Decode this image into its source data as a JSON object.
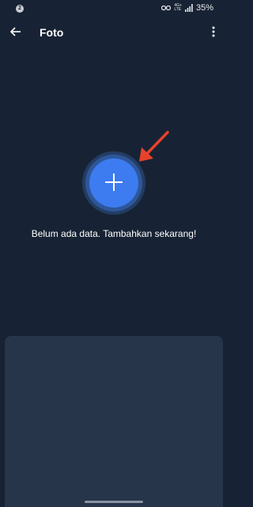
{
  "status_bar": {
    "notification_count": "2",
    "network_label_top": "4G+",
    "network_label_bottom": "LTE",
    "battery_percent": "35%"
  },
  "app_bar": {
    "title": "Foto",
    "back_icon": "arrow-back-icon",
    "menu_icon": "more-vert-icon"
  },
  "main": {
    "add_icon": "plus-icon",
    "empty_message": "Belum ada data. Tambahkan sekarang!"
  },
  "colors": {
    "background": "#172334",
    "accent": "#3d7bf0",
    "annotation_arrow": "#e8412c",
    "panel": "#26354a"
  }
}
